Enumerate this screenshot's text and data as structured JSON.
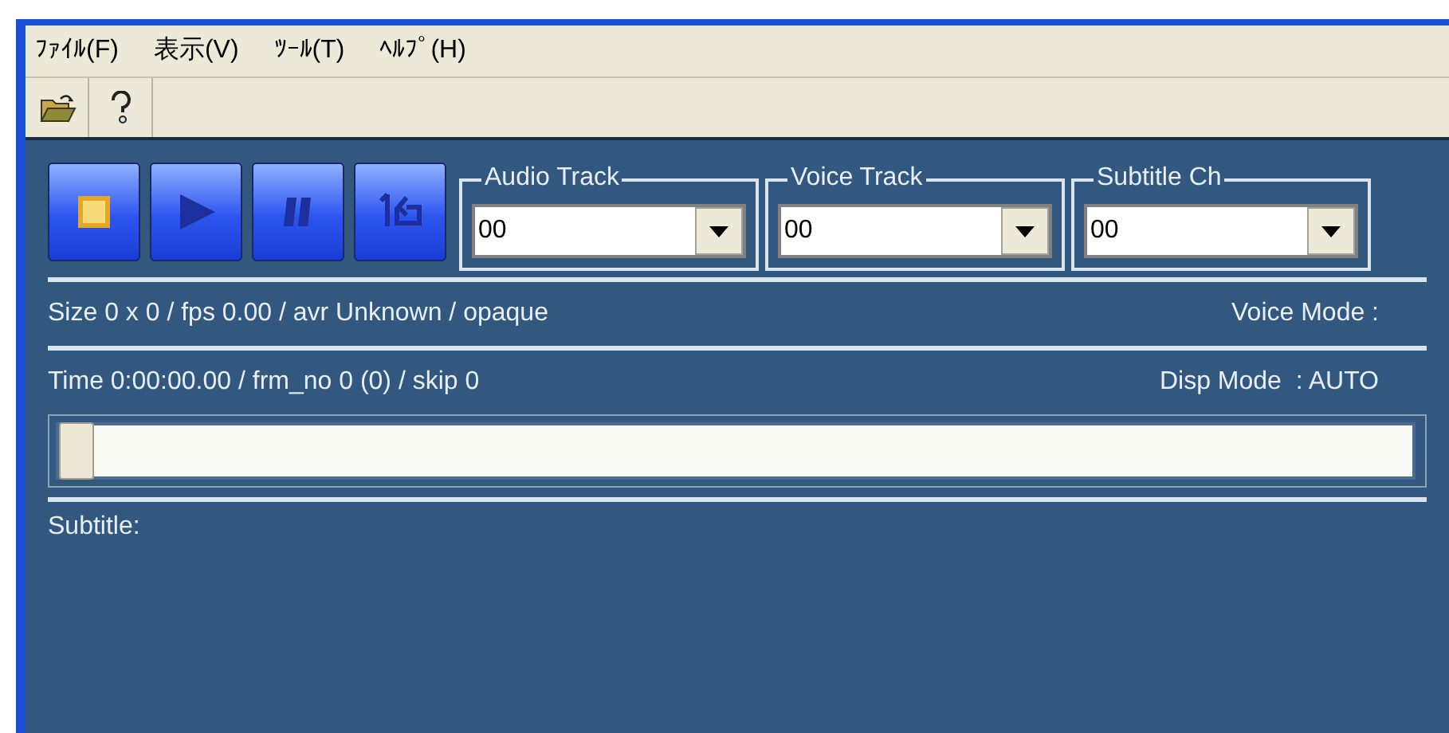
{
  "menu": [
    "ﾌｧｲﾙ(F)",
    "表示(V)",
    "ﾂｰﾙ(T)",
    "ﾍﾙﾌﾟ(H)"
  ],
  "toolbar": [
    {
      "kind": "open"
    },
    {
      "kind": "help"
    }
  ],
  "transport": [
    {
      "kind": "stop"
    },
    {
      "kind": "play"
    },
    {
      "kind": "pause"
    },
    {
      "kind": "step"
    }
  ],
  "selectors": [
    {
      "label": "Audio Track",
      "value": "00"
    },
    {
      "label": "Voice Track",
      "value": "00"
    },
    {
      "label": "Subtitle Ch",
      "value": "00"
    }
  ],
  "info_line": {
    "text": "Size 0 x 0 / fps 0.00 / avr Unknown / opaque",
    "mode": "Voice Mode :"
  },
  "time_line": {
    "text": "Time 0:00:00.00 / frm_no 0 (0) / skip 0",
    "mode": "Disp Mode  : AUTO"
  },
  "seek": {
    "level": 0
  },
  "subtitle": "Subtitle:"
}
